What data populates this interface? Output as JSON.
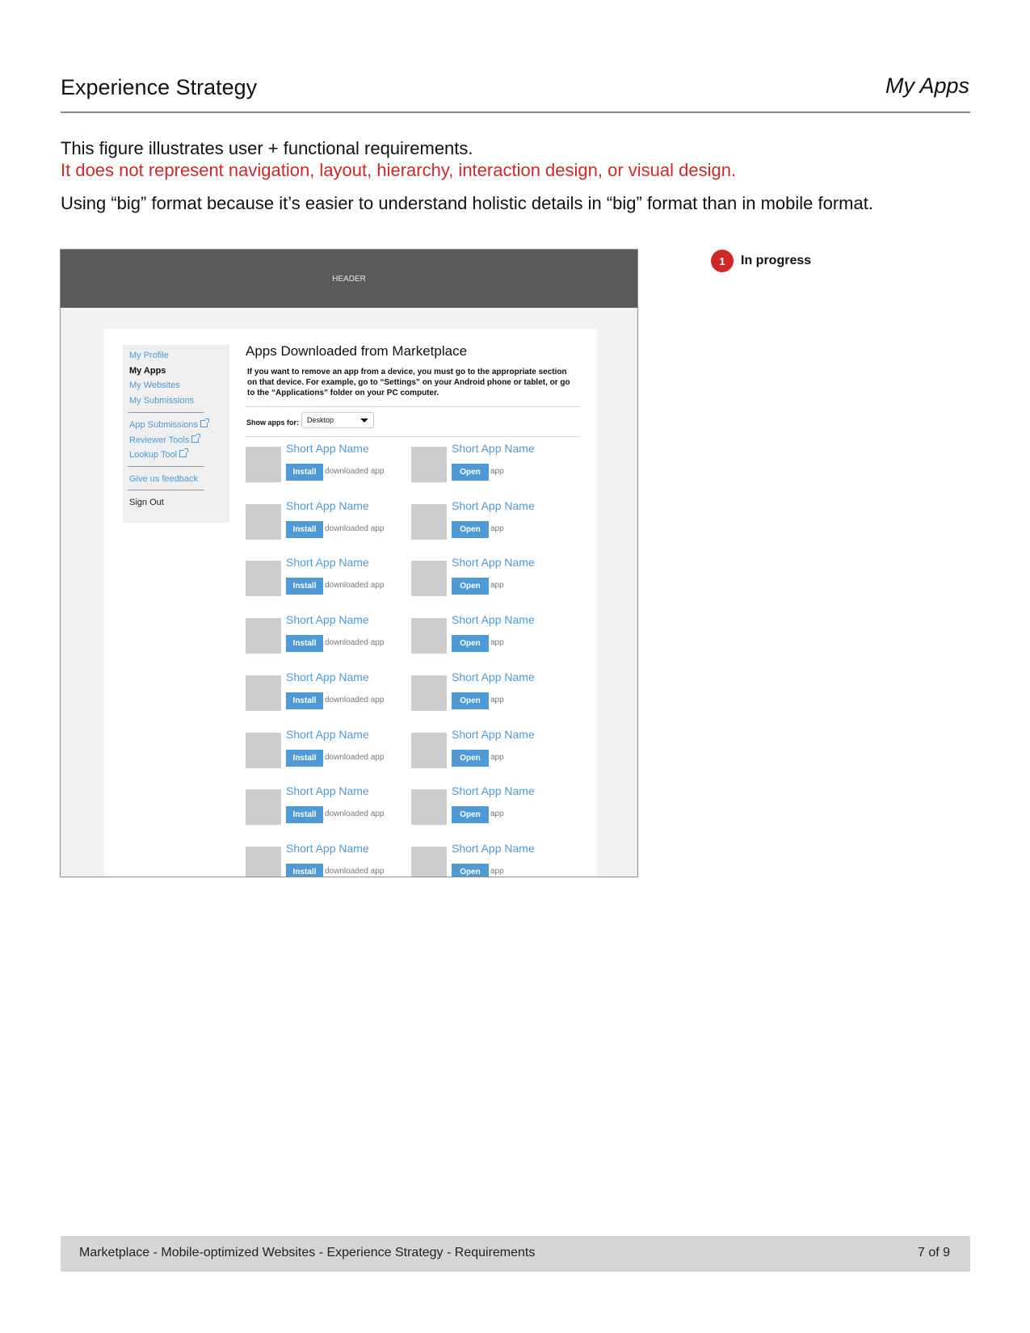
{
  "page": {
    "title": "Experience Strategy",
    "section": "My Apps",
    "intro_line1": "This figure illustrates user + functional requirements.",
    "intro_line2": "It does not represent navigation, layout, hierarchy, interaction design, or visual design.",
    "intro_line3": "Using “big” format because it’s easier to understand holistic details in “big” format than in mobile format."
  },
  "wireframe": {
    "header_label": "HEADER",
    "nav": {
      "my_profile": "My Profile",
      "my_apps": "My Apps",
      "my_websites": "My Websites",
      "my_submissions": "My Submissions",
      "app_submissions": "App Submissions",
      "reviewer_tools": "Reviewer Tools",
      "lookup_tool": "Lookup Tool",
      "feedback": "Give us feedback",
      "sign_out": "Sign Out"
    },
    "main_title": "Apps Downloaded from Marketplace",
    "main_note": "If you want to remove an app from a device, you must go to the appropriate section on that device. For example, go to “Settings” on your Android phone or tablet, or go to the “Applications” folder on your PC computer.",
    "filter_label": "Show apps for:",
    "filter_value": "Desktop",
    "apps": [
      {
        "left": {
          "name": "Short App Name",
          "action": "Install",
          "status": "downloaded app"
        },
        "right": {
          "name": "Short App Name",
          "action": "Open",
          "status": "app"
        }
      },
      {
        "left": {
          "name": "Short App Name",
          "action": "Install",
          "status": "downloaded app"
        },
        "right": {
          "name": "Short App Name",
          "action": "Open",
          "status": "app"
        }
      },
      {
        "left": {
          "name": "Short App Name",
          "action": "Install",
          "status": "downloaded app"
        },
        "right": {
          "name": "Short App Name",
          "action": "Open",
          "status": "app"
        }
      },
      {
        "left": {
          "name": "Short App Name",
          "action": "Install",
          "status": "downloaded app"
        },
        "right": {
          "name": "Short App Name",
          "action": "Open",
          "status": "app"
        }
      },
      {
        "left": {
          "name": "Short App Name",
          "action": "Install",
          "status": "downloaded app"
        },
        "right": {
          "name": "Short App Name",
          "action": "Open",
          "status": "app"
        }
      },
      {
        "left": {
          "name": "Short App Name",
          "action": "Install",
          "status": "downloaded app"
        },
        "right": {
          "name": "Short App Name",
          "action": "Open",
          "status": "app"
        }
      },
      {
        "left": {
          "name": "Short App Name",
          "action": "Install",
          "status": "downloaded app"
        },
        "right": {
          "name": "Short App Name",
          "action": "Open",
          "status": "app"
        }
      },
      {
        "left": {
          "name": "Short App Name",
          "action": "Install",
          "status": "downloaded app"
        },
        "right": {
          "name": "Short App Name",
          "action": "Open",
          "status": "app"
        }
      }
    ]
  },
  "callout": {
    "number": "1",
    "label": "In progress"
  },
  "footer": {
    "text": "Marketplace - Mobile-optimized Websites - Experience Strategy - Requirements",
    "page": "7 of 9"
  },
  "colors": {
    "accent_red": "#d02828",
    "link_blue": "#4d9ad6",
    "header_gray": "#5a5a5b"
  }
}
